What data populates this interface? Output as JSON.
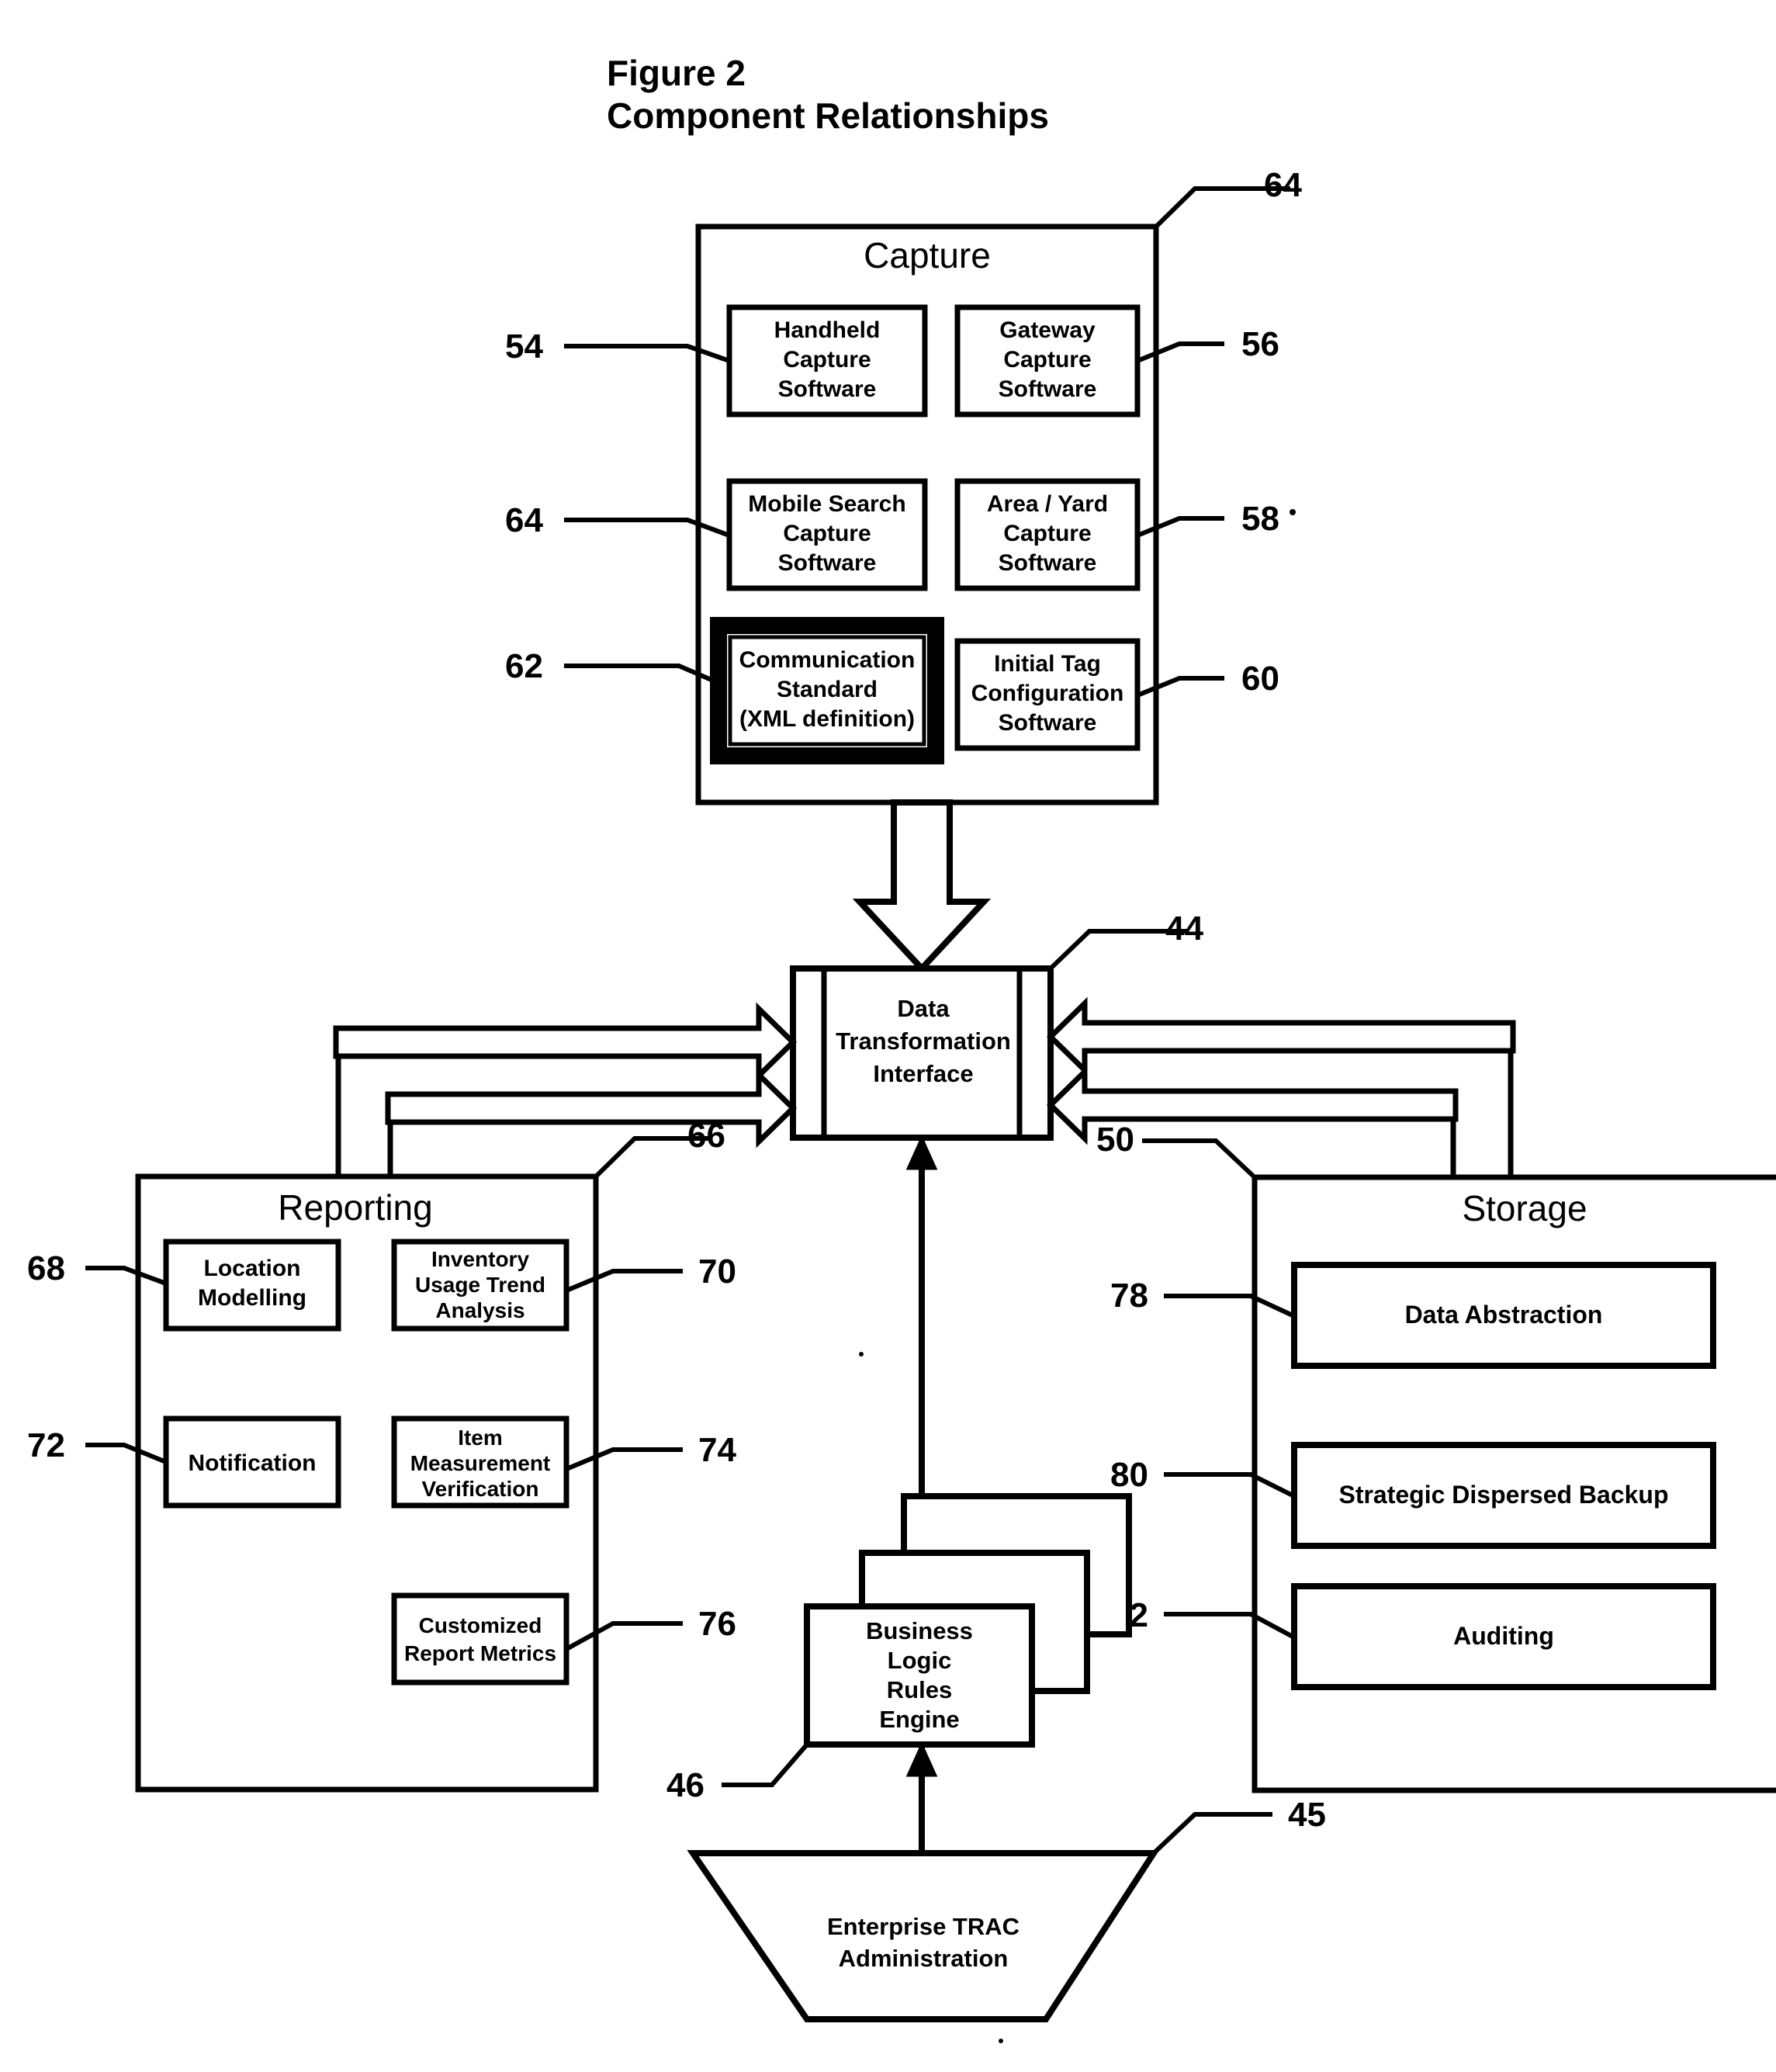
{
  "figure": {
    "title_line1": "Figure 2",
    "title_line2": "Component Relationships"
  },
  "groups": {
    "capture": {
      "label": "Capture",
      "ref": "64"
    },
    "reporting": {
      "label": "Reporting",
      "ref": "66"
    },
    "storage": {
      "label": "Storage",
      "ref": "50"
    }
  },
  "capture_items": [
    {
      "ref": "54",
      "side": "left",
      "lines": [
        "Handheld",
        "Capture",
        "Software"
      ]
    },
    {
      "ref": "56",
      "side": "right",
      "lines": [
        "Gateway",
        "Capture",
        "Software"
      ]
    },
    {
      "ref": "64",
      "side": "left",
      "lines": [
        "Mobile Search",
        "Capture",
        "Software"
      ]
    },
    {
      "ref": "58",
      "side": "right",
      "lines": [
        "Area / Yard",
        "Capture",
        "Software"
      ]
    },
    {
      "ref": "62",
      "side": "left",
      "lines": [
        "Communication",
        "Standard",
        "(XML definition)"
      ],
      "emphasis": "thick"
    },
    {
      "ref": "60",
      "side": "right",
      "lines": [
        "Initial Tag",
        "Configuration",
        "Software"
      ]
    }
  ],
  "reporting_items": [
    {
      "ref": "68",
      "side": "left",
      "lines": [
        "Location",
        "Modelling"
      ]
    },
    {
      "ref": "70",
      "side": "right",
      "lines": [
        "Inventory",
        "Usage Trend",
        "Analysis"
      ]
    },
    {
      "ref": "72",
      "side": "left",
      "lines": [
        "Notification"
      ]
    },
    {
      "ref": "74",
      "side": "right",
      "lines": [
        "Item",
        "Measurement",
        "Verification"
      ]
    },
    {
      "ref": "76",
      "side": "right",
      "lines": [
        "Customized",
        "Report Metrics"
      ]
    }
  ],
  "storage_items": [
    {
      "ref": "78",
      "lines": [
        "Data Abstraction"
      ]
    },
    {
      "ref": "80",
      "lines": [
        "Strategic Dispersed Backup"
      ]
    },
    {
      "ref": "82",
      "lines": [
        "Auditing"
      ]
    }
  ],
  "hub": {
    "ref": "44",
    "lines": [
      "Data",
      "Transformation",
      "Interface"
    ]
  },
  "engine": {
    "ref": "46",
    "lines": [
      "Business",
      "Logic",
      "Rules",
      "Engine"
    ],
    "stacked_copies": 2
  },
  "admin": {
    "ref": "45",
    "lines": [
      "Enterprise TRAC",
      "Administration"
    ]
  },
  "colors": {
    "stroke": "#000000",
    "fill": "#ffffff",
    "background": "#ffffff"
  }
}
